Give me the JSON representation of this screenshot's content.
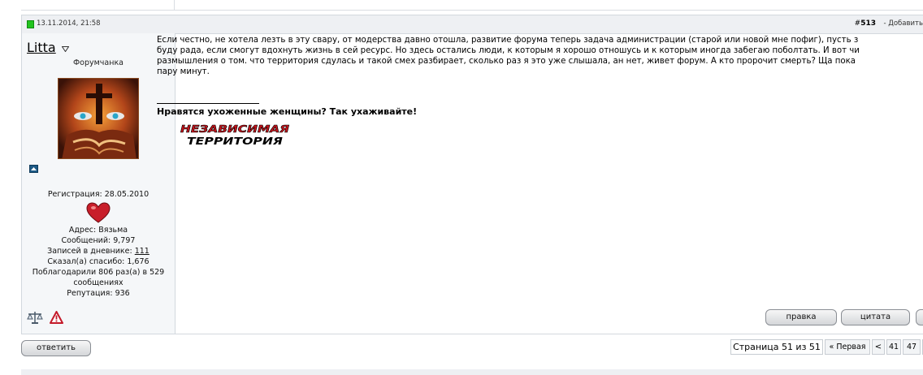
{
  "post": {
    "date": "13.11.2014, 21:58",
    "number_prefix": "#",
    "number": "513",
    "add_link": "- Добавить"
  },
  "user": {
    "name": "Litta",
    "rank": "Форумчанка",
    "registration": "Регистрация: 28.05.2010",
    "address": "Адрес: Вязьма",
    "messages": "Сообщений: 9,797",
    "diary_label": "Записей в дневнике: ",
    "diary_count": "111",
    "said_thanks": "Сказал(а) спасибо: 1,676",
    "thanked_line1": "Поблагодарили 806 раз(а) в 529",
    "thanked_line2": "сообщениях",
    "reputation": "Репутация: 936"
  },
  "message": {
    "line1": "Если честно, не хотела лезть в эту свару, от модерства давно отошла, развитие форума теперь задача администрации (старой или новой мне пофиг), пусть з",
    "line2": "буду рада, если смогут вдохнуть жизнь в сей ресурс. Но здесь остались люди, к которым я хорошо отношусь и к которым иногда забегаю поболтать. И вот чи",
    "line3": "размышления о том. что территория сдулась и такой смех разбирает, сколько раз я это уже слышала, ан нет, живет форум. А кто пророчит смерть? Ща пока",
    "line4": "пару минут."
  },
  "signature": {
    "text": "Нравятся ухоженные женщины? Так ухаживайте!",
    "banner_line1": "НЕЗАВИСИМАЯ",
    "banner_line2": "ТЕРРИТОРИЯ"
  },
  "buttons": {
    "edit": "правка",
    "quote": "цитата",
    "reply": "ответить"
  },
  "pagination": {
    "info": "Страница 51 из 51",
    "first": "« Первая",
    "prev": "<",
    "pages": [
      "41",
      "47"
    ],
    "more": "-"
  },
  "colors": {
    "online": "#22c41e",
    "header_bg": "#eef0f3",
    "user_bg": "#f5f7f9",
    "border": "#d3d8de",
    "heart": "#c81e2a",
    "banner_red": "#c8141c"
  },
  "icons": {
    "online_status": "green-square-icon",
    "user_menu": "triangle-down-icon",
    "reputation": "reputation-icon",
    "heart": "heart-icon",
    "scales": "scales-icon",
    "report": "warning-triangle-icon"
  }
}
